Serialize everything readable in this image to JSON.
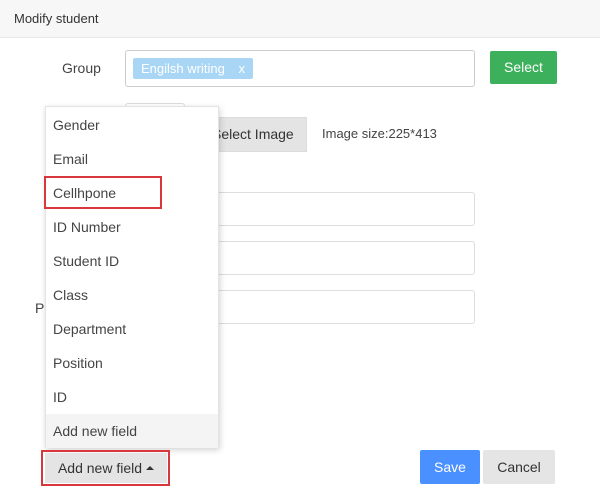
{
  "dialog": {
    "title": "Modify student"
  },
  "form": {
    "group_label": "Group",
    "group_tags": [
      {
        "label": "Engilsh writing",
        "remove_symbol": "x"
      }
    ],
    "select_button": "Select",
    "select_image_button": "Select Image",
    "image_size_text": "Image size:225*413",
    "partial_label": "P"
  },
  "dropdown": {
    "items": [
      "Gender",
      "Email",
      "Cellhpone",
      "ID Number",
      "Student ID",
      "Class",
      "Department",
      "Position",
      "ID",
      "Add new field"
    ],
    "highlighted_item": "Cellhpone"
  },
  "footer": {
    "add_field_button": "Add new field",
    "save_button": "Save",
    "cancel_button": "Cancel"
  },
  "colors": {
    "select_green": "#3cb05a",
    "save_blue": "#4a90ff",
    "tag_blue": "#a9d6f5",
    "highlight_red": "#d9373e"
  },
  "icons": {
    "add_field_caret": "caret-up-icon",
    "tag_remove": "close-icon"
  }
}
